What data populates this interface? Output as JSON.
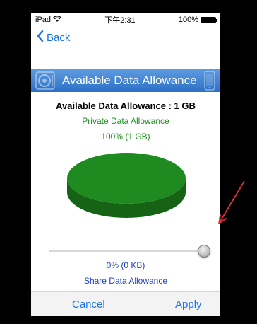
{
  "status_bar": {
    "device": "iPad",
    "wifi_icon": "wifi-icon",
    "time": "下午2:31",
    "battery": "100%"
  },
  "nav": {
    "back_label": "Back"
  },
  "header": {
    "title": "Available Data Allowance"
  },
  "main": {
    "available_label": "Available Data Allowance : 1 GB",
    "private_label": "Private Data Allowance",
    "private_value": "100% (1 GB)",
    "share_value": "0% (0 KB)",
    "share_label": "Share Data Allowance"
  },
  "chart_data": {
    "type": "pie",
    "slices": [
      {
        "label": "Private Data Allowance",
        "value": 100,
        "color": "#1f8a1f"
      },
      {
        "label": "Share Data Allowance",
        "value": 0,
        "color": "#1f3fd6"
      }
    ]
  },
  "slider": {
    "value": 1.0
  },
  "footer": {
    "cancel_label": "Cancel",
    "apply_label": "Apply"
  },
  "colors": {
    "accent_blue": "#1a73e8",
    "green": "#1e8f1e",
    "share_blue": "#1f3fd6",
    "header_blue": "#2c6fc6"
  }
}
